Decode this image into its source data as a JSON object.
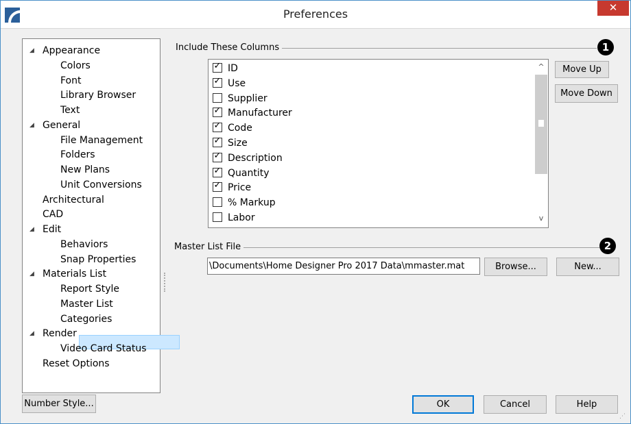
{
  "window": {
    "title": "Preferences",
    "close_glyph": "✕"
  },
  "tree": {
    "items": [
      {
        "label": "Appearance",
        "expanded": true,
        "level": 0
      },
      {
        "label": "Colors",
        "level": 1
      },
      {
        "label": "Font",
        "level": 1
      },
      {
        "label": "Library Browser",
        "level": 1
      },
      {
        "label": "Text",
        "level": 1
      },
      {
        "label": "General",
        "expanded": true,
        "level": 0
      },
      {
        "label": "File Management",
        "level": 1
      },
      {
        "label": "Folders",
        "level": 1
      },
      {
        "label": "New Plans",
        "level": 1
      },
      {
        "label": "Unit Conversions",
        "level": 1
      },
      {
        "label": "Architectural",
        "level": 0
      },
      {
        "label": "CAD",
        "level": 0
      },
      {
        "label": "Edit",
        "expanded": true,
        "level": 0
      },
      {
        "label": "Behaviors",
        "level": 1
      },
      {
        "label": "Snap Properties",
        "level": 1
      },
      {
        "label": "Materials List",
        "expanded": true,
        "level": 0
      },
      {
        "label": "Report Style",
        "level": 1
      },
      {
        "label": "Master List",
        "level": 1,
        "selected": true
      },
      {
        "label": "Categories",
        "level": 1
      },
      {
        "label": "Render",
        "expanded": true,
        "level": 0
      },
      {
        "label": "Video Card Status",
        "level": 1
      },
      {
        "label": "Reset Options",
        "level": 0
      }
    ],
    "expand_glyph": "◢"
  },
  "columns_group": {
    "label": "Include These Columns",
    "badge": "1",
    "items": [
      {
        "label": "ID",
        "checked": true
      },
      {
        "label": "Use",
        "checked": true
      },
      {
        "label": "Supplier",
        "checked": false
      },
      {
        "label": "Manufacturer",
        "checked": true
      },
      {
        "label": "Code",
        "checked": true
      },
      {
        "label": "Size",
        "checked": true
      },
      {
        "label": "Description",
        "checked": true
      },
      {
        "label": "Quantity",
        "checked": true
      },
      {
        "label": "Price",
        "checked": true
      },
      {
        "label": "% Markup",
        "checked": false
      },
      {
        "label": "Labor",
        "checked": false
      }
    ],
    "check_glyph": "✓",
    "scroll_position": 0,
    "move_up_label": "Move Up",
    "move_down_label": "Move Down"
  },
  "master_group": {
    "label": "Master List File",
    "badge": "2",
    "path": "\\Documents\\Home Designer Pro 2017 Data\\mmaster.mat",
    "browse_label": "Browse...",
    "new_label": "New..."
  },
  "footer": {
    "number_style_label": "Number Style...",
    "ok_label": "OK",
    "cancel_label": "Cancel",
    "help_label": "Help"
  },
  "colors": {
    "selection": "#cce8ff",
    "close": "#c7392f",
    "accent": "#0078d7"
  }
}
